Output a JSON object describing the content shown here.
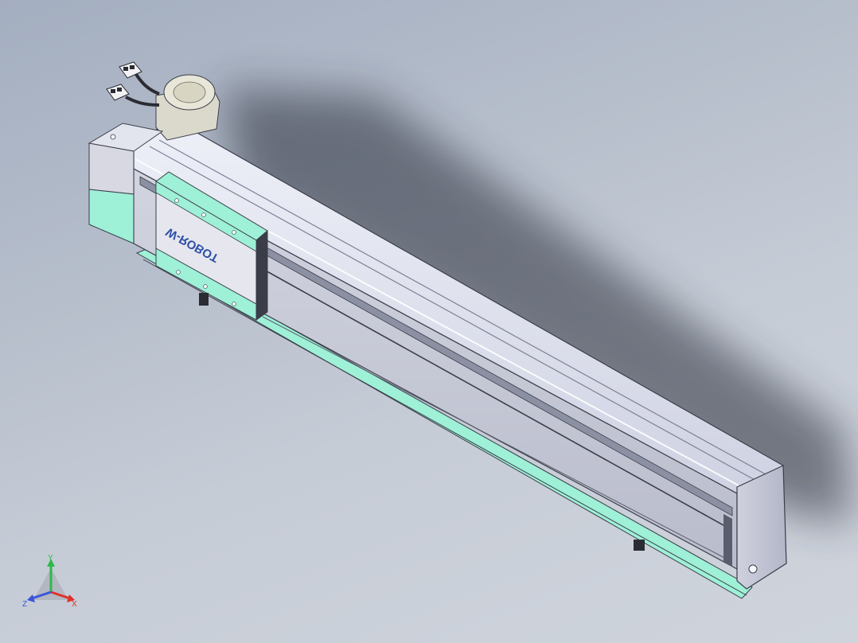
{
  "model": {
    "brand_text": "W-ROBOT"
  },
  "triad": {
    "x_label": "X",
    "y_label": "Y",
    "z_label": "Z",
    "x_color": "#e0302a",
    "y_color": "#2fb84a",
    "z_color": "#3a55d8"
  },
  "colors": {
    "aluminum_light": "#e4e6f2",
    "aluminum_mid": "#c9ccdc",
    "aluminum_dark": "#9ea3b8",
    "accent_teal": "#9ef0d6",
    "edge": "#3b3d4a"
  }
}
